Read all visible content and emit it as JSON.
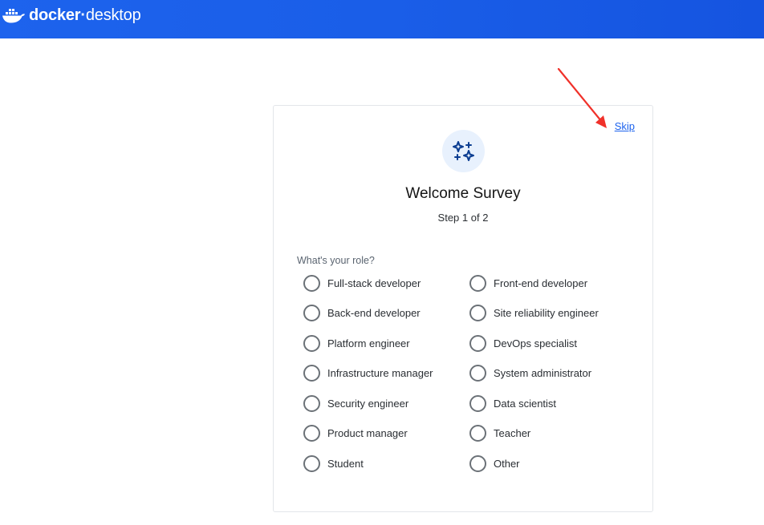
{
  "app": {
    "brand_bold": "docker",
    "brand_light": "desktop"
  },
  "survey": {
    "skip_label": "Skip",
    "title": "Welcome Survey",
    "step": "Step 1 of 2",
    "question": "What's your role?",
    "options_left": [
      "Full-stack developer",
      "Back-end developer",
      "Platform engineer",
      "Infrastructure manager",
      "Security engineer",
      "Product manager",
      "Student"
    ],
    "options_right": [
      "Front-end developer",
      "Site reliability engineer",
      "DevOps specialist",
      "System administrator",
      "Data scientist",
      "Teacher",
      "Other"
    ]
  },
  "colors": {
    "topbar": "#1d63ed",
    "link": "#1d63ed",
    "badge_bg": "#e8f1fd",
    "badge_icon": "#0b3d91",
    "annotation_arrow": "#f0312a"
  },
  "icons": {
    "logo": "docker-whale-icon",
    "badge": "sparkles-icon"
  }
}
